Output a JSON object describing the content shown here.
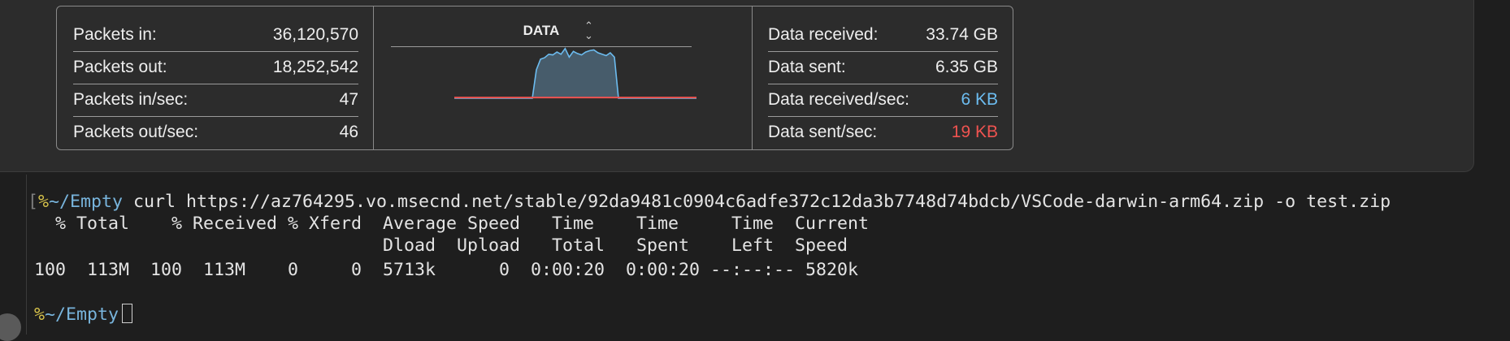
{
  "left_stats": [
    {
      "label": "Packets in:",
      "value": "36,120,570"
    },
    {
      "label": "Packets out:",
      "value": "18,252,542"
    },
    {
      "label": "Packets in/sec:",
      "value": "47"
    },
    {
      "label": "Packets out/sec:",
      "value": "46"
    }
  ],
  "graph": {
    "mode_label": "DATA",
    "chevron_icon": "up-down-chevron-icon",
    "chart_data": {
      "type": "area",
      "series": [
        {
          "color": "#6cbcf0",
          "values": [
            0,
            0,
            0,
            0,
            0,
            0,
            0,
            0,
            0,
            0,
            0,
            0,
            0,
            0,
            0,
            0,
            0,
            0,
            0,
            0,
            40,
            55,
            57,
            62,
            61,
            65,
            62,
            70,
            58,
            66,
            63,
            61,
            65,
            67,
            68,
            64,
            62,
            60,
            64,
            58,
            0,
            0,
            0,
            0,
            0,
            0,
            0,
            0,
            0,
            0,
            0,
            0,
            0,
            0,
            0,
            0,
            0,
            0,
            0,
            0
          ]
        },
        {
          "color": "#ef5350",
          "values": [
            1,
            1,
            1,
            1,
            1,
            1,
            1,
            1,
            1,
            1,
            1,
            1,
            1,
            1,
            1,
            1,
            1,
            1,
            1,
            1,
            1,
            1,
            1,
            1,
            1,
            1,
            1,
            1,
            1,
            1,
            1,
            1,
            1,
            1,
            1,
            1,
            1,
            1,
            1,
            1,
            1,
            1,
            1,
            1,
            1,
            1,
            1,
            1,
            1,
            1,
            1,
            1,
            1,
            1,
            1,
            1,
            1,
            1,
            1,
            1
          ]
        }
      ],
      "ylim": [
        0,
        80
      ]
    }
  },
  "right_stats": [
    {
      "label": "Data received:",
      "value": "33.74 GB",
      "color": "#eeeeee"
    },
    {
      "label": "Data sent:",
      "value": "6.35 GB",
      "color": "#eeeeee"
    },
    {
      "label": "Data received/sec:",
      "value": "6 KB",
      "color": "#6cbcf0"
    },
    {
      "label": "Data sent/sec:",
      "value": "19 KB",
      "color": "#ef5350"
    }
  ],
  "terminal": {
    "prompt_bracket": "[",
    "prompt_symbol": "%",
    "cwd": "~/Empty",
    "command": " curl https://az764295.vo.msecnd.net/stable/92da9481c0904c6adfe372c12da3b7748d74bdcb/VSCode-darwin-arm64.zip -o test.zip",
    "header1": "  % Total    % Received % Xferd  Average Speed   Time    Time     Time  Current",
    "header2": "                                 Dload  Upload   Total   Spent    Left  Speed",
    "progress": "100  113M  100  113M    0     0  5713k      0  0:00:20  0:00:20 --:--:-- 5820k",
    "prompt2_symbol": "%",
    "prompt2_cwd": "~/Empty"
  }
}
